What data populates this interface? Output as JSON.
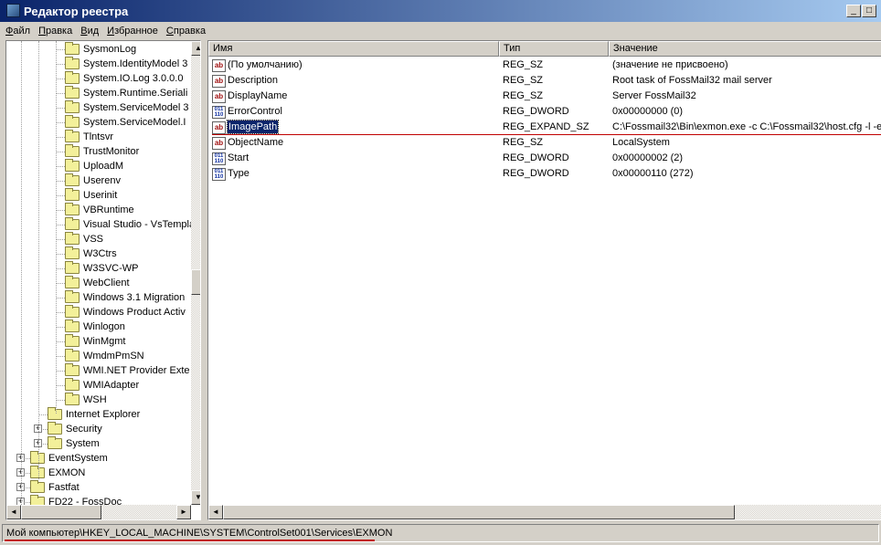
{
  "window": {
    "title": "Редактор реестра",
    "minimize": "_",
    "maximize": "□"
  },
  "menu": [
    "Файл",
    "Правка",
    "Вид",
    "Избранное",
    "Справка"
  ],
  "tree": [
    {
      "label": "SysmonLog",
      "level": 3
    },
    {
      "label": "System.IdentityModel 3",
      "level": 3
    },
    {
      "label": "System.IO.Log 3.0.0.0",
      "level": 3
    },
    {
      "label": "System.Runtime.Seriali",
      "level": 3
    },
    {
      "label": "System.ServiceModel 3",
      "level": 3
    },
    {
      "label": "System.ServiceModel.I",
      "level": 3
    },
    {
      "label": "Tlntsvr",
      "level": 3
    },
    {
      "label": "TrustMonitor",
      "level": 3
    },
    {
      "label": "UploadM",
      "level": 3
    },
    {
      "label": "Userenv",
      "level": 3
    },
    {
      "label": "Userinit",
      "level": 3
    },
    {
      "label": "VBRuntime",
      "level": 3
    },
    {
      "label": "Visual Studio - VsTempla",
      "level": 3
    },
    {
      "label": "VSS",
      "level": 3
    },
    {
      "label": "W3Ctrs",
      "level": 3
    },
    {
      "label": "W3SVC-WP",
      "level": 3
    },
    {
      "label": "WebClient",
      "level": 3
    },
    {
      "label": "Windows 3.1 Migration",
      "level": 3
    },
    {
      "label": "Windows Product Activ",
      "level": 3
    },
    {
      "label": "Winlogon",
      "level": 3
    },
    {
      "label": "WinMgmt",
      "level": 3
    },
    {
      "label": "WmdmPmSN",
      "level": 3
    },
    {
      "label": "WMI.NET Provider Exte",
      "level": 3
    },
    {
      "label": "WMIAdapter",
      "level": 3
    },
    {
      "label": "WSH",
      "level": 3
    },
    {
      "label": "Internet Explorer",
      "level": 2
    },
    {
      "label": "Security",
      "level": 2,
      "expandable": true
    },
    {
      "label": "System",
      "level": 2,
      "expandable": true
    },
    {
      "label": "EventSystem",
      "level": 1,
      "expandable": true
    },
    {
      "label": "EXMON",
      "level": 1,
      "expandable": true,
      "open": true
    },
    {
      "label": "Fastfat",
      "level": 1,
      "expandable": true
    },
    {
      "label": "FD22 - FossDoc",
      "level": 1,
      "expandable": true
    }
  ],
  "list": {
    "columns": [
      "Имя",
      "Тип",
      "Значение"
    ],
    "rows": [
      {
        "icon": "string-value-icon",
        "name": "(По умолчанию)",
        "type": "REG_SZ",
        "value": "(значение не присвоено)"
      },
      {
        "icon": "string-value-icon",
        "name": "Description",
        "type": "REG_SZ",
        "value": "Root task of FossMail32 mail server"
      },
      {
        "icon": "string-value-icon",
        "name": "DisplayName",
        "type": "REG_SZ",
        "value": "Server FossMail32"
      },
      {
        "icon": "binary-value-icon",
        "name": "ErrorControl",
        "type": "REG_DWORD",
        "value": "0x00000000 (0)"
      },
      {
        "icon": "string-value-icon",
        "name": "ImagePath",
        "type": "REG_EXPAND_SZ",
        "value": "C:\\Fossmail32\\Bin\\exmon.exe -c C:\\Fossmail32\\host.cfg -l -e",
        "selected": true
      },
      {
        "icon": "string-value-icon",
        "name": "ObjectName",
        "type": "REG_SZ",
        "value": "LocalSystem"
      },
      {
        "icon": "binary-value-icon",
        "name": "Start",
        "type": "REG_DWORD",
        "value": "0x00000002 (2)"
      },
      {
        "icon": "binary-value-icon",
        "name": "Type",
        "type": "REG_DWORD",
        "value": "0x00000110 (272)"
      }
    ]
  },
  "status": "Мой компьютер\\HKEY_LOCAL_MACHINE\\SYSTEM\\ControlSet001\\Services\\EXMON",
  "colors": {
    "titlebar": "#0a246a",
    "selection": "#0a246a",
    "annotation": "#c00000"
  }
}
